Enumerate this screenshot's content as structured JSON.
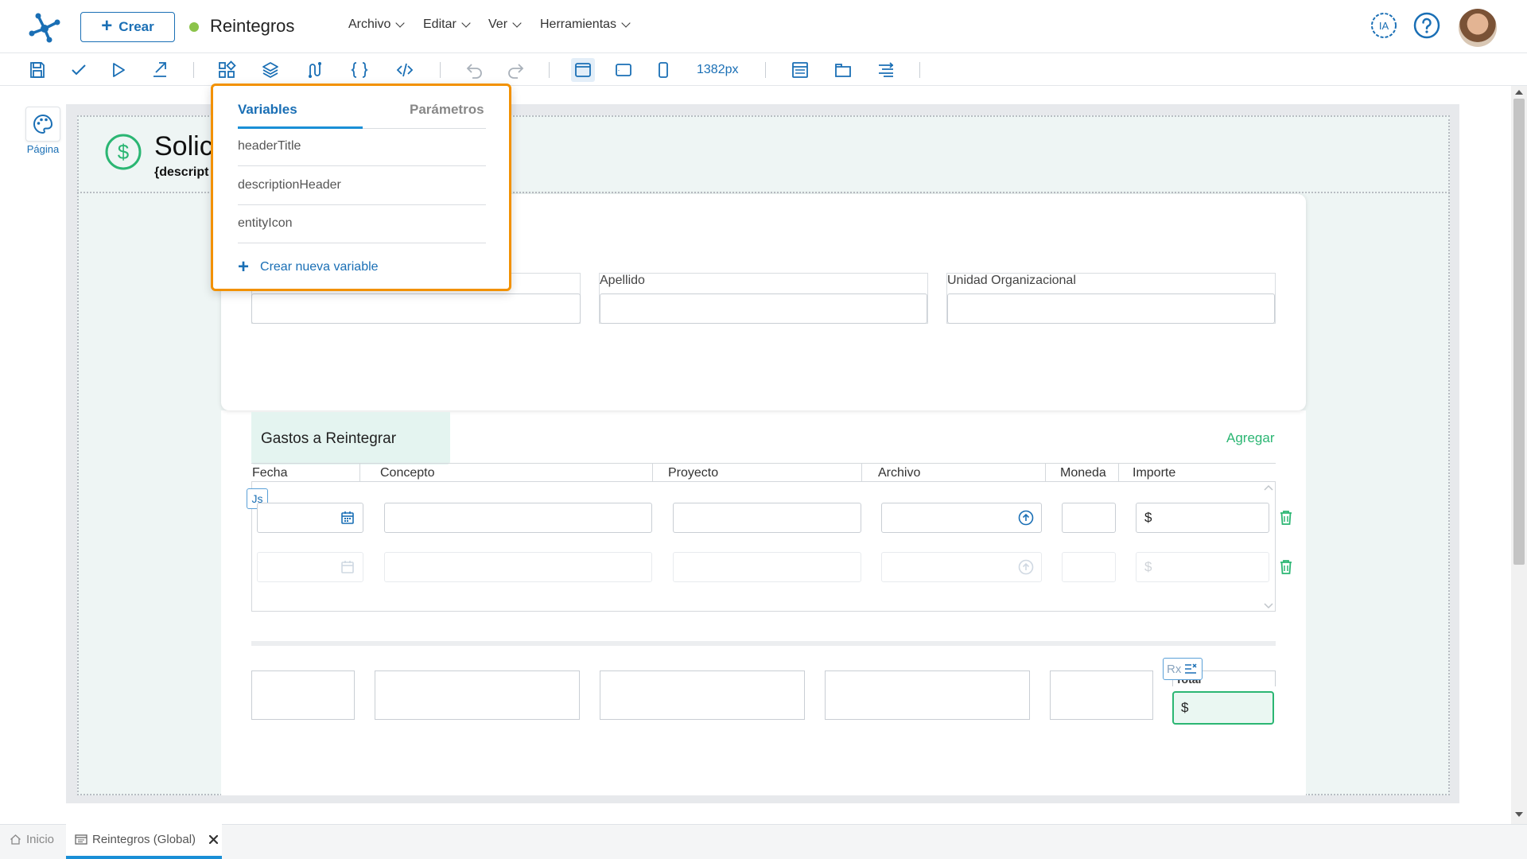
{
  "header": {
    "create_label": "Crear",
    "app_title": "Reintegros",
    "menus": [
      "Archivo",
      "Editar",
      "Ver",
      "Herramientas"
    ],
    "ia_label": "IA"
  },
  "toolbar": {
    "width_label": "1382px"
  },
  "sidebar": {
    "page_label": "Página"
  },
  "canvas": {
    "header_title": "Solic",
    "header_desc": "{descript"
  },
  "form": {
    "fields": [
      "Apellido",
      "Unidad Organizacional"
    ]
  },
  "grid": {
    "title": "Gastos a Reintegrar",
    "add_label": "Agregar",
    "columns": [
      "Fecha",
      "Concepto",
      "Proyecto",
      "Archivo",
      "Moneda",
      "Importe"
    ],
    "currency_symbol": "$",
    "js_badge": "Js"
  },
  "totals": {
    "label": "Total",
    "currency_symbol": "$",
    "rx_badge": "Rx"
  },
  "dropdown": {
    "tab_variables": "Variables",
    "tab_parameters": "Parámetros",
    "items": [
      "headerTitle",
      "descriptionHeader",
      "entityIcon"
    ],
    "create_label": "Crear nueva variable"
  },
  "bottom_tabs": {
    "home": "Inicio",
    "active": "Reintegros (Global)"
  },
  "colors": {
    "brand": "#1a6fb5",
    "accent_green": "#2bb673",
    "highlight_orange": "#f29100"
  }
}
